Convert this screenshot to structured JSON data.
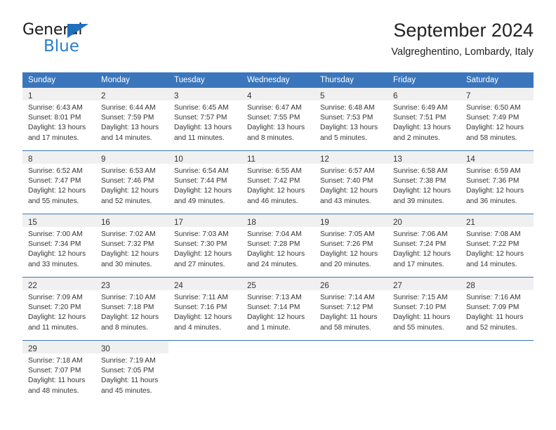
{
  "brand": {
    "name_top": "General",
    "name_bottom": "Blue",
    "triangle_color": "#1e6fbd",
    "blue_text_color": "#2a7fc9"
  },
  "header": {
    "title": "September 2024",
    "subtitle": "Valgreghentino, Lombardy, Italy"
  },
  "theme": {
    "header_blue": "#3b76bc",
    "daynum_band": "#f0f0f0",
    "text": "#333333"
  },
  "weekdays": [
    "Sunday",
    "Monday",
    "Tuesday",
    "Wednesday",
    "Thursday",
    "Friday",
    "Saturday"
  ],
  "weeks": [
    [
      {
        "day": "1",
        "sunrise": "Sunrise: 6:43 AM",
        "sunset": "Sunset: 8:01 PM",
        "daylight1": "Daylight: 13 hours",
        "daylight2": "and 17 minutes."
      },
      {
        "day": "2",
        "sunrise": "Sunrise: 6:44 AM",
        "sunset": "Sunset: 7:59 PM",
        "daylight1": "Daylight: 13 hours",
        "daylight2": "and 14 minutes."
      },
      {
        "day": "3",
        "sunrise": "Sunrise: 6:45 AM",
        "sunset": "Sunset: 7:57 PM",
        "daylight1": "Daylight: 13 hours",
        "daylight2": "and 11 minutes."
      },
      {
        "day": "4",
        "sunrise": "Sunrise: 6:47 AM",
        "sunset": "Sunset: 7:55 PM",
        "daylight1": "Daylight: 13 hours",
        "daylight2": "and 8 minutes."
      },
      {
        "day": "5",
        "sunrise": "Sunrise: 6:48 AM",
        "sunset": "Sunset: 7:53 PM",
        "daylight1": "Daylight: 13 hours",
        "daylight2": "and 5 minutes."
      },
      {
        "day": "6",
        "sunrise": "Sunrise: 6:49 AM",
        "sunset": "Sunset: 7:51 PM",
        "daylight1": "Daylight: 13 hours",
        "daylight2": "and 2 minutes."
      },
      {
        "day": "7",
        "sunrise": "Sunrise: 6:50 AM",
        "sunset": "Sunset: 7:49 PM",
        "daylight1": "Daylight: 12 hours",
        "daylight2": "and 58 minutes."
      }
    ],
    [
      {
        "day": "8",
        "sunrise": "Sunrise: 6:52 AM",
        "sunset": "Sunset: 7:47 PM",
        "daylight1": "Daylight: 12 hours",
        "daylight2": "and 55 minutes."
      },
      {
        "day": "9",
        "sunrise": "Sunrise: 6:53 AM",
        "sunset": "Sunset: 7:46 PM",
        "daylight1": "Daylight: 12 hours",
        "daylight2": "and 52 minutes."
      },
      {
        "day": "10",
        "sunrise": "Sunrise: 6:54 AM",
        "sunset": "Sunset: 7:44 PM",
        "daylight1": "Daylight: 12 hours",
        "daylight2": "and 49 minutes."
      },
      {
        "day": "11",
        "sunrise": "Sunrise: 6:55 AM",
        "sunset": "Sunset: 7:42 PM",
        "daylight1": "Daylight: 12 hours",
        "daylight2": "and 46 minutes."
      },
      {
        "day": "12",
        "sunrise": "Sunrise: 6:57 AM",
        "sunset": "Sunset: 7:40 PM",
        "daylight1": "Daylight: 12 hours",
        "daylight2": "and 43 minutes."
      },
      {
        "day": "13",
        "sunrise": "Sunrise: 6:58 AM",
        "sunset": "Sunset: 7:38 PM",
        "daylight1": "Daylight: 12 hours",
        "daylight2": "and 39 minutes."
      },
      {
        "day": "14",
        "sunrise": "Sunrise: 6:59 AM",
        "sunset": "Sunset: 7:36 PM",
        "daylight1": "Daylight: 12 hours",
        "daylight2": "and 36 minutes."
      }
    ],
    [
      {
        "day": "15",
        "sunrise": "Sunrise: 7:00 AM",
        "sunset": "Sunset: 7:34 PM",
        "daylight1": "Daylight: 12 hours",
        "daylight2": "and 33 minutes."
      },
      {
        "day": "16",
        "sunrise": "Sunrise: 7:02 AM",
        "sunset": "Sunset: 7:32 PM",
        "daylight1": "Daylight: 12 hours",
        "daylight2": "and 30 minutes."
      },
      {
        "day": "17",
        "sunrise": "Sunrise: 7:03 AM",
        "sunset": "Sunset: 7:30 PM",
        "daylight1": "Daylight: 12 hours",
        "daylight2": "and 27 minutes."
      },
      {
        "day": "18",
        "sunrise": "Sunrise: 7:04 AM",
        "sunset": "Sunset: 7:28 PM",
        "daylight1": "Daylight: 12 hours",
        "daylight2": "and 24 minutes."
      },
      {
        "day": "19",
        "sunrise": "Sunrise: 7:05 AM",
        "sunset": "Sunset: 7:26 PM",
        "daylight1": "Daylight: 12 hours",
        "daylight2": "and 20 minutes."
      },
      {
        "day": "20",
        "sunrise": "Sunrise: 7:06 AM",
        "sunset": "Sunset: 7:24 PM",
        "daylight1": "Daylight: 12 hours",
        "daylight2": "and 17 minutes."
      },
      {
        "day": "21",
        "sunrise": "Sunrise: 7:08 AM",
        "sunset": "Sunset: 7:22 PM",
        "daylight1": "Daylight: 12 hours",
        "daylight2": "and 14 minutes."
      }
    ],
    [
      {
        "day": "22",
        "sunrise": "Sunrise: 7:09 AM",
        "sunset": "Sunset: 7:20 PM",
        "daylight1": "Daylight: 12 hours",
        "daylight2": "and 11 minutes."
      },
      {
        "day": "23",
        "sunrise": "Sunrise: 7:10 AM",
        "sunset": "Sunset: 7:18 PM",
        "daylight1": "Daylight: 12 hours",
        "daylight2": "and 8 minutes."
      },
      {
        "day": "24",
        "sunrise": "Sunrise: 7:11 AM",
        "sunset": "Sunset: 7:16 PM",
        "daylight1": "Daylight: 12 hours",
        "daylight2": "and 4 minutes."
      },
      {
        "day": "25",
        "sunrise": "Sunrise: 7:13 AM",
        "sunset": "Sunset: 7:14 PM",
        "daylight1": "Daylight: 12 hours",
        "daylight2": "and 1 minute."
      },
      {
        "day": "26",
        "sunrise": "Sunrise: 7:14 AM",
        "sunset": "Sunset: 7:12 PM",
        "daylight1": "Daylight: 11 hours",
        "daylight2": "and 58 minutes."
      },
      {
        "day": "27",
        "sunrise": "Sunrise: 7:15 AM",
        "sunset": "Sunset: 7:10 PM",
        "daylight1": "Daylight: 11 hours",
        "daylight2": "and 55 minutes."
      },
      {
        "day": "28",
        "sunrise": "Sunrise: 7:16 AM",
        "sunset": "Sunset: 7:09 PM",
        "daylight1": "Daylight: 11 hours",
        "daylight2": "and 52 minutes."
      }
    ],
    [
      {
        "day": "29",
        "sunrise": "Sunrise: 7:18 AM",
        "sunset": "Sunset: 7:07 PM",
        "daylight1": "Daylight: 11 hours",
        "daylight2": "and 48 minutes."
      },
      {
        "day": "30",
        "sunrise": "Sunrise: 7:19 AM",
        "sunset": "Sunset: 7:05 PM",
        "daylight1": "Daylight: 11 hours",
        "daylight2": "and 45 minutes."
      },
      {
        "day": "",
        "sunrise": "",
        "sunset": "",
        "daylight1": "",
        "daylight2": ""
      },
      {
        "day": "",
        "sunrise": "",
        "sunset": "",
        "daylight1": "",
        "daylight2": ""
      },
      {
        "day": "",
        "sunrise": "",
        "sunset": "",
        "daylight1": "",
        "daylight2": ""
      },
      {
        "day": "",
        "sunrise": "",
        "sunset": "",
        "daylight1": "",
        "daylight2": ""
      },
      {
        "day": "",
        "sunrise": "",
        "sunset": "",
        "daylight1": "",
        "daylight2": ""
      }
    ]
  ]
}
